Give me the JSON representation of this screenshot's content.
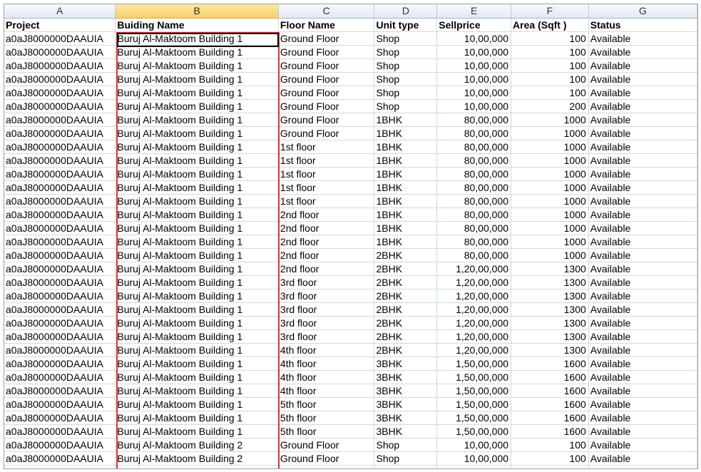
{
  "columns": [
    "A",
    "B",
    "C",
    "D",
    "E",
    "F",
    "G"
  ],
  "headers": [
    "Project",
    "Buiding Name",
    "Floor Name",
    "Unit type",
    "Sellprice",
    "Area (Sqft )",
    "Status"
  ],
  "rows": [
    [
      "a0aJ8000000DAAUIA",
      "Buruj Al-Maktoom Building 1",
      "Ground Floor",
      "Shop",
      "10,00,000",
      "100",
      "Available"
    ],
    [
      "a0aJ8000000DAAUIA",
      "Buruj Al-Maktoom Building 1",
      "Ground Floor",
      "Shop",
      "10,00,000",
      "100",
      "Available"
    ],
    [
      "a0aJ8000000DAAUIA",
      "Buruj Al-Maktoom Building 1",
      "Ground Floor",
      "Shop",
      "10,00,000",
      "100",
      "Available"
    ],
    [
      "a0aJ8000000DAAUIA",
      "Buruj Al-Maktoom Building 1",
      "Ground Floor",
      "Shop",
      "10,00,000",
      "100",
      "Available"
    ],
    [
      "a0aJ8000000DAAUIA",
      "Buruj Al-Maktoom Building 1",
      "Ground Floor",
      "Shop",
      "10,00,000",
      "100",
      "Available"
    ],
    [
      "a0aJ8000000DAAUIA",
      "Buruj Al-Maktoom Building 1",
      "Ground Floor",
      "Shop",
      "10,00,000",
      "200",
      "Available"
    ],
    [
      "a0aJ8000000DAAUIA",
      "Buruj Al-Maktoom Building 1",
      "Ground Floor",
      "1BHK",
      "80,00,000",
      "1000",
      "Available"
    ],
    [
      "a0aJ8000000DAAUIA",
      "Buruj Al-Maktoom Building 1",
      "Ground Floor",
      "1BHK",
      "80,00,000",
      "1000",
      "Available"
    ],
    [
      "a0aJ8000000DAAUIA",
      "Buruj Al-Maktoom Building 1",
      "1st floor",
      "1BHK",
      "80,00,000",
      "1000",
      "Available"
    ],
    [
      "a0aJ8000000DAAUIA",
      "Buruj Al-Maktoom Building 1",
      "1st floor",
      "1BHK",
      "80,00,000",
      "1000",
      "Available"
    ],
    [
      "a0aJ8000000DAAUIA",
      "Buruj Al-Maktoom Building 1",
      "1st floor",
      "1BHK",
      "80,00,000",
      "1000",
      "Available"
    ],
    [
      "a0aJ8000000DAAUIA",
      "Buruj Al-Maktoom Building 1",
      "1st floor",
      "1BHK",
      "80,00,000",
      "1000",
      "Available"
    ],
    [
      "a0aJ8000000DAAUIA",
      "Buruj Al-Maktoom Building 1",
      "1st floor",
      "1BHK",
      "80,00,000",
      "1000",
      "Available"
    ],
    [
      "a0aJ8000000DAAUIA",
      "Buruj Al-Maktoom Building 1",
      "2nd floor",
      "1BHK",
      "80,00,000",
      "1000",
      "Available"
    ],
    [
      "a0aJ8000000DAAUIA",
      "Buruj Al-Maktoom Building 1",
      "2nd floor",
      "1BHK",
      "80,00,000",
      "1000",
      "Available"
    ],
    [
      "a0aJ8000000DAAUIA",
      "Buruj Al-Maktoom Building 1",
      "2nd floor",
      "1BHK",
      "80,00,000",
      "1000",
      "Available"
    ],
    [
      "a0aJ8000000DAAUIA",
      "Buruj Al-Maktoom Building 1",
      "2nd floor",
      "2BHK",
      "80,00,000",
      "1000",
      "Available"
    ],
    [
      "a0aJ8000000DAAUIA",
      "Buruj Al-Maktoom Building 1",
      "2nd floor",
      "2BHK",
      "1,20,00,000",
      "1300",
      "Available"
    ],
    [
      "a0aJ8000000DAAUIA",
      "Buruj Al-Maktoom Building 1",
      "3rd floor",
      "2BHK",
      "1,20,00,000",
      "1300",
      "Available"
    ],
    [
      "a0aJ8000000DAAUIA",
      "Buruj Al-Maktoom Building 1",
      "3rd floor",
      "2BHK",
      "1,20,00,000",
      "1300",
      "Available"
    ],
    [
      "a0aJ8000000DAAUIA",
      "Buruj Al-Maktoom Building 1",
      "3rd floor",
      "2BHK",
      "1,20,00,000",
      "1300",
      "Available"
    ],
    [
      "a0aJ8000000DAAUIA",
      "Buruj Al-Maktoom Building 1",
      "3rd floor",
      "2BHK",
      "1,20,00,000",
      "1300",
      "Available"
    ],
    [
      "a0aJ8000000DAAUIA",
      "Buruj Al-Maktoom Building 1",
      "3rd floor",
      "2BHK",
      "1,20,00,000",
      "1300",
      "Available"
    ],
    [
      "a0aJ8000000DAAUIA",
      "Buruj Al-Maktoom Building 1",
      "4th floor",
      "2BHK",
      "1,20,00,000",
      "1300",
      "Available"
    ],
    [
      "a0aJ8000000DAAUIA",
      "Buruj Al-Maktoom Building 1",
      "4th floor",
      "3BHK",
      "1,50,00,000",
      "1600",
      "Available"
    ],
    [
      "a0aJ8000000DAAUIA",
      "Buruj Al-Maktoom Building 1",
      "4th floor",
      "3BHK",
      "1,50,00,000",
      "1600",
      "Available"
    ],
    [
      "a0aJ8000000DAAUIA",
      "Buruj Al-Maktoom Building 1",
      "4th floor",
      "3BHK",
      "1,50,00,000",
      "1600",
      "Available"
    ],
    [
      "a0aJ8000000DAAUIA",
      "Buruj Al-Maktoom Building 1",
      "5th floor",
      "3BHK",
      "1,50,00,000",
      "1600",
      "Available"
    ],
    [
      "a0aJ8000000DAAUIA",
      "Buruj Al-Maktoom Building 1",
      "5th floor",
      "3BHK",
      "1,50,00,000",
      "1600",
      "Available"
    ],
    [
      "a0aJ8000000DAAUIA",
      "Buruj Al-Maktoom Building 1",
      "5th floor",
      "3BHK",
      "1,50,00,000",
      "1600",
      "Available"
    ],
    [
      "a0aJ8000000DAAUIA",
      "Buruj Al-Maktoom Building 2",
      "Ground Floor",
      "Shop",
      "10,00,000",
      "100",
      "Available"
    ],
    [
      "a0aJ8000000DAAUIA",
      "Buruj Al-Maktoom Building 2",
      "Ground Floor",
      "Shop",
      "10,00,000",
      "100",
      "Available"
    ],
    [
      "a0aJ8000000DAAUIA",
      "Buruj Al-Maktoom Building 2",
      "Ground Floor",
      "Shop",
      "10,00,000",
      "100",
      "Available"
    ]
  ],
  "selected_column": "B",
  "colors": {
    "selection_border": "#e03030",
    "selected_header": "#f8d068",
    "gridline": "#d0d7e5"
  }
}
